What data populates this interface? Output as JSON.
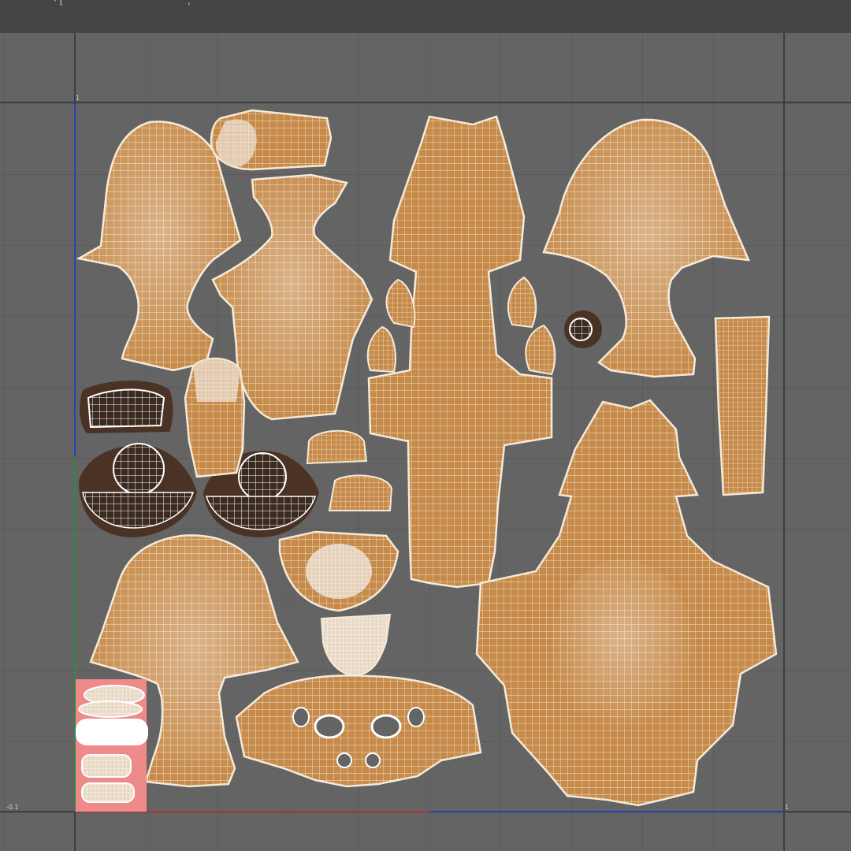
{
  "toolbar": {
    "glyphs": "· [",
    "glyph_end": ","
  },
  "uv_axes": {
    "u_min_label": "-0.1",
    "u_max_label": "1",
    "v_max_label": "1"
  },
  "colors": {
    "background": "#646464",
    "toolbar": "#454545",
    "uv_shell_fill": "#c68a4a",
    "uv_wire": "#f6e9d6",
    "selected_shell": "#4a3324",
    "overlap_shell": "#ee8a8a",
    "u_axis": "#d03030",
    "v_axis": "#2aa040",
    "range_line": "#2040d0"
  }
}
